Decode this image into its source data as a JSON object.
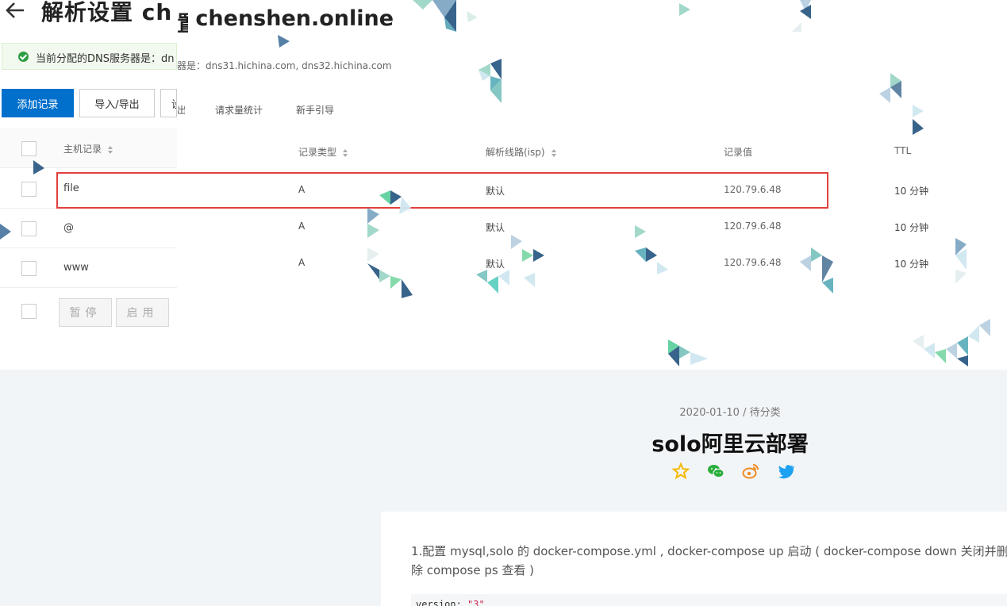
{
  "banner": {
    "title_left": "解析设置 ch",
    "title_right": "chenshen.online",
    "notice_text": "当前分配的DNS服务器是：dn",
    "dns_servers_text": "器是：dns31.hichina.com, dns32.hichina.com",
    "toolbar": {
      "add_label": "添加记录",
      "import_label": "导入/导出",
      "more_label": "设"
    },
    "tabs": {
      "fragment": "出",
      "stats": "请求量统计",
      "guide": "新手引导"
    },
    "table": {
      "headers": {
        "host": "主机记录",
        "type": "记录类型",
        "line": "解析线路(isp)",
        "value": "记录值",
        "ttl": "TTL"
      },
      "rows": [
        {
          "host": "file",
          "type": "A",
          "line": "默认",
          "value": "120.79.6.48",
          "ttl": "10 分钟"
        },
        {
          "host": "@",
          "type": "A",
          "line": "默认",
          "value": "120.79.6.48",
          "ttl": "10 分钟"
        },
        {
          "host": "www",
          "type": "A",
          "line": "默认",
          "value": "120.79.6.48",
          "ttl": "10 分钟"
        }
      ],
      "footer": {
        "pause_label": "暂停",
        "enable_label": "启用"
      }
    }
  },
  "post": {
    "date": "2020-01-10",
    "separator": "/",
    "category": "待分类",
    "title": "solo阿里云部署",
    "share_icons": [
      "star-icon",
      "wechat-icon",
      "weibo-icon",
      "twitter-icon"
    ],
    "paragraph": "1.配置 mysql,solo 的 docker-compose.yml , docker-compose up 启动 ( docker-compose down 关闭并删除 compose ps 查看 )",
    "code_key": "version: ",
    "code_value": "\"3\""
  },
  "colors": {
    "primary_button": "#0070cc",
    "highlight_border": "#e2403c",
    "article_bg": "#f2f5f8",
    "star": "#f5b800",
    "wechat": "#2aae3b",
    "weibo": "#ef8a1e",
    "twitter": "#1da1f2"
  }
}
